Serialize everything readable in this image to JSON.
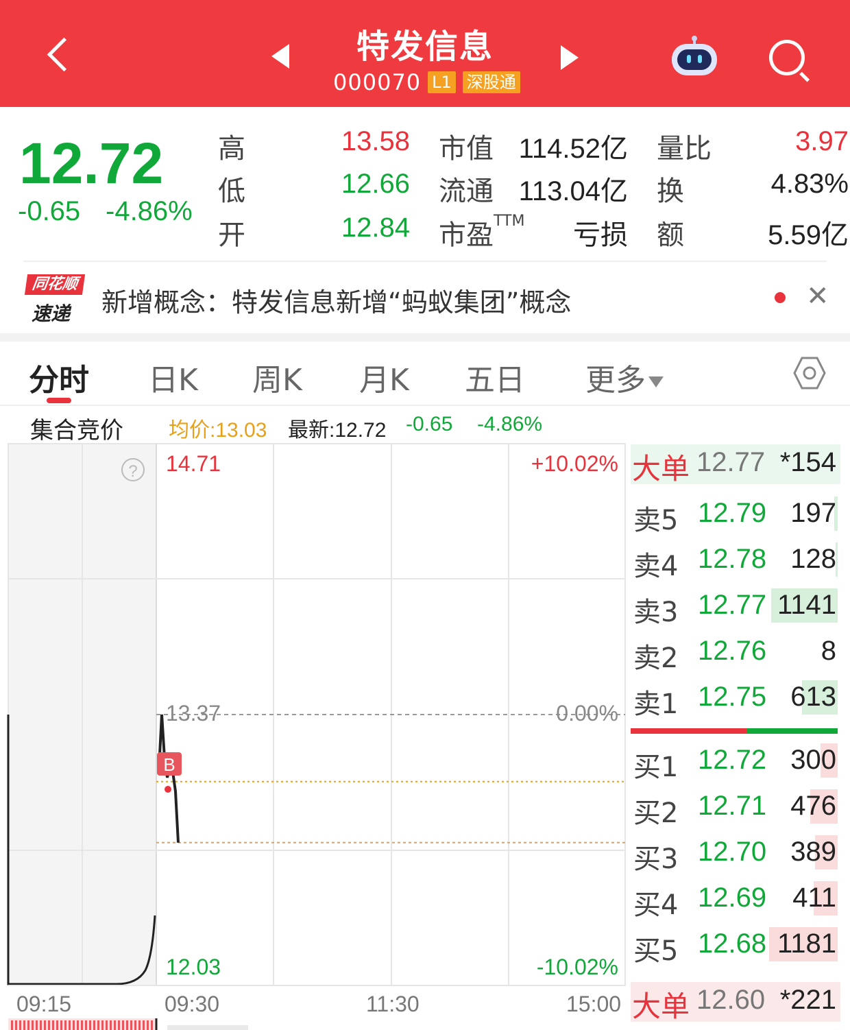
{
  "header": {
    "stock_name": "特发信息",
    "stock_code": "000070",
    "level_badge": "L1",
    "connect_badge": "深股通",
    "accent_color": "#ef3a3f"
  },
  "quote": {
    "last_price": "12.72",
    "change": "-0.65",
    "change_pct": "-4.86%",
    "high_label": "高",
    "high": "13.58",
    "low_label": "低",
    "low": "12.66",
    "open_label": "开",
    "open": "12.84",
    "mktcap_label": "市值",
    "mktcap": "114.52亿",
    "float_label": "流通",
    "float": "113.04亿",
    "pe_label": "市盈",
    "pe_tm": "TTM",
    "pe": "亏损",
    "vol_ratio_label": "量比",
    "vol_ratio": "3.97",
    "turnover_label": "换",
    "turnover": "4.83%",
    "amount_label": "额",
    "amount": "5.59亿"
  },
  "news": {
    "logo_top": "同花顺",
    "logo_bottom": "速递",
    "text": "新增概念：特发信息新增“蚂蚁集团”概念"
  },
  "tabs": [
    {
      "label": "分时",
      "active": true
    },
    {
      "label": "日K"
    },
    {
      "label": "周K"
    },
    {
      "label": "月K"
    },
    {
      "label": "五日"
    },
    {
      "label": "更多"
    }
  ],
  "info_bar": {
    "auction_label": "集合竞价",
    "avg_price": "均价:13.03",
    "latest": "最新:12.72",
    "change": "-0.65",
    "change_pct": "-4.86%"
  },
  "chart": {
    "price_top": "14.71",
    "price_mid": "13.37",
    "price_bottom": "12.03",
    "pct_top": "+10.02%",
    "pct_mid": "0.00%",
    "pct_bottom": "-10.02%",
    "times": [
      "09:15",
      "09:30",
      "11:30",
      "15:00"
    ],
    "trade_marker": "B",
    "help_icon": "question-icon"
  },
  "chart_data": {
    "type": "line",
    "title": "",
    "ylim": [
      12.03,
      14.71
    ],
    "prev_close": 13.37,
    "avg_price": 13.03,
    "series": [
      {
        "values": [
          13.1,
          13.37,
          13.15,
          13.05,
          13.11,
          13.08,
          12.98,
          12.72
        ]
      }
    ]
  },
  "order_book": {
    "big_top": {
      "label": "大单",
      "price": "12.77",
      "volume": "*154"
    },
    "asks": [
      {
        "label": "卖5",
        "price": "12.79",
        "volume": "197",
        "bar": 0.05
      },
      {
        "label": "卖4",
        "price": "12.78",
        "volume": "128",
        "bar": 0.03
      },
      {
        "label": "卖3",
        "price": "12.77",
        "volume": "1141",
        "bar": 0.97
      },
      {
        "label": "卖2",
        "price": "12.76",
        "volume": "8",
        "bar": 0.0
      },
      {
        "label": "卖1",
        "price": "12.75",
        "volume": "613",
        "bar": 0.52
      }
    ],
    "bids": [
      {
        "label": "买1",
        "price": "12.72",
        "volume": "300",
        "bar": 0.25
      },
      {
        "label": "买2",
        "price": "12.71",
        "volume": "476",
        "bar": 0.4
      },
      {
        "label": "买3",
        "price": "12.70",
        "volume": "389",
        "bar": 0.33
      },
      {
        "label": "买4",
        "price": "12.69",
        "volume": "411",
        "bar": 0.35
      },
      {
        "label": "买5",
        "price": "12.68",
        "volume": "1181",
        "bar": 1.0
      }
    ],
    "big_bottom": {
      "label": "大单",
      "price": "12.60",
      "volume": "*221"
    }
  },
  "colors": {
    "up": "#e8323c",
    "down": "#11a83a",
    "avg": "#e8a018"
  }
}
